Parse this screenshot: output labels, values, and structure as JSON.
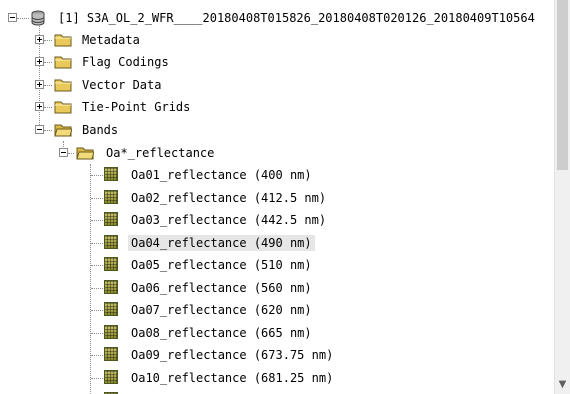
{
  "product": {
    "label": "[1] S3A_OL_2_WFR____20180408T015826_20180408T020126_20180409T10564",
    "children": [
      {
        "label": "Metadata"
      },
      {
        "label": "Flag Codings"
      },
      {
        "label": "Vector Data"
      },
      {
        "label": "Tie-Point Grids"
      },
      {
        "label": "Bands"
      }
    ]
  },
  "band_group": {
    "label": "Oa*_reflectance",
    "bands": [
      {
        "label": "Oa01_reflectance (400 nm)"
      },
      {
        "label": "Oa02_reflectance (412.5 nm)"
      },
      {
        "label": "Oa03_reflectance (442.5 nm)"
      },
      {
        "label": "Oa04_reflectance (490 nm)",
        "selected": true
      },
      {
        "label": "Oa05_reflectance (510 nm)"
      },
      {
        "label": "Oa06_reflectance (560 nm)"
      },
      {
        "label": "Oa07_reflectance (620 nm)"
      },
      {
        "label": "Oa08_reflectance (665 nm)"
      },
      {
        "label": "Oa09_reflectance (673.75 nm)"
      },
      {
        "label": "Oa10_reflectance (681.25 nm)"
      }
    ]
  },
  "icons": {
    "product": "database-icon",
    "folder": "folder-icon",
    "open_folder": "open-folder-icon",
    "band": "band-raster-icon",
    "expander_expanded": "collapse-icon",
    "expander_collapsed": "expand-icon",
    "scroll_down": "scroll-down-arrow-icon"
  },
  "colors": {
    "folder": "#e8c95a",
    "selection": "#e6e6e6",
    "band_icon": "#a7a43f"
  }
}
